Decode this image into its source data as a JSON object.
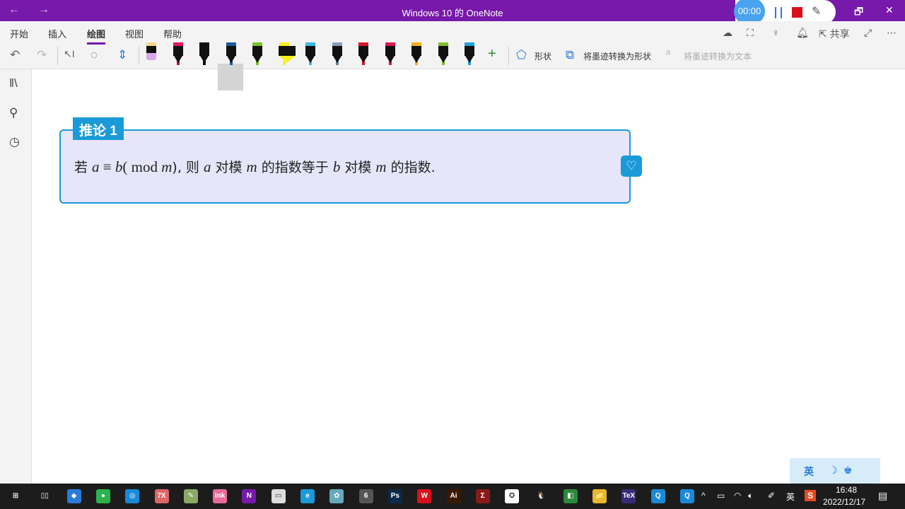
{
  "titlebar": {
    "title": "Windows 10 的 OneNote",
    "back": "←",
    "forward": "→",
    "restore": "🗗",
    "close": "✕"
  },
  "recorder": {
    "timer": "00:00"
  },
  "ribbon": {
    "tabs": [
      {
        "label": "开始"
      },
      {
        "label": "插入"
      },
      {
        "label": "绘图"
      },
      {
        "label": "视图"
      },
      {
        "label": "帮助"
      }
    ],
    "active_tab": "绘图",
    "share_label": "共享",
    "shapes_label": "形状",
    "ink_to_shape_label": "将墨迹转换为形状",
    "ink_to_text_label": "将墨迹转换为文本",
    "add_pen": "+",
    "pens": [
      {
        "cap": "#f5d890",
        "tip": "#d8a8e8",
        "type": "eraser"
      },
      {
        "cap": "#e8195a",
        "tip": "#c0103a"
      },
      {
        "cap": "#111111",
        "tip": "#111111"
      },
      {
        "cap": "#1f5a9a",
        "tip": "#1f5a9a"
      },
      {
        "cap": "#7ac12a",
        "tip": "#7ac12a"
      },
      {
        "cap": "#f5f020",
        "tip": "#f5f020"
      },
      {
        "cap": "#3cb8e8",
        "tip": "#3cb8e8"
      },
      {
        "cap": "#8aa0b8",
        "tip": "#6a8098"
      },
      {
        "cap": "#d8182a",
        "tip": "#d8182a"
      },
      {
        "cap": "#e0184a",
        "tip": "#e0184a"
      },
      {
        "cap": "#f5b020",
        "tip": "#f5b020"
      },
      {
        "cap": "#80c030",
        "tip": "#80c030"
      },
      {
        "cap": "#20a0d8",
        "tip": "#20a0d8"
      }
    ]
  },
  "note": {
    "tag": "推论 1",
    "t1": "若 ",
    "a": "a",
    "eq": " ≡ ",
    "b": "b",
    "paren": "(  ",
    "mod": "mod ",
    "m": "m",
    "t2": "), 则 ",
    "t3": " 对模 ",
    "t4": " 的指数等于 ",
    "t5": " 的指数."
  },
  "ime": {
    "lang": "英"
  },
  "taskbar": {
    "apps": [
      {
        "name": "start",
        "label": "⊞",
        "color": "transparent"
      },
      {
        "name": "task-view",
        "label": "▯▯",
        "color": "transparent"
      },
      {
        "name": "feishu",
        "label": "◆",
        "color": "#2a7ad8"
      },
      {
        "name": "wechat",
        "label": "●",
        "color": "#2bb24c"
      },
      {
        "name": "browser",
        "label": "◎",
        "color": "#1a8ad8"
      },
      {
        "name": "7x",
        "label": "7X",
        "color": "#d66"
      },
      {
        "name": "paint",
        "label": "✎",
        "color": "#8a6"
      },
      {
        "name": "app-pink",
        "label": "ink",
        "color": "#e86a9a"
      },
      {
        "name": "onenote",
        "label": "N",
        "color": "#7719aa"
      },
      {
        "name": "monitor",
        "label": "▭",
        "color": "#ddd"
      },
      {
        "name": "edge",
        "label": "e",
        "color": "#1a9ad8"
      },
      {
        "name": "app-flower",
        "label": "✿",
        "color": "#6ab"
      },
      {
        "name": "app-6",
        "label": "6",
        "color": "#555"
      },
      {
        "name": "photoshop",
        "label": "Ps",
        "color": "#0a2a48"
      },
      {
        "name": "wps",
        "label": "W",
        "color": "#d8101c"
      },
      {
        "name": "illustrator",
        "label": "Ai",
        "color": "#3a1800"
      },
      {
        "name": "app-sigma",
        "label": "Σ",
        "color": "#8a1a1a"
      },
      {
        "name": "app-gear",
        "label": "✪",
        "color": "#fff"
      },
      {
        "name": "qq",
        "label": "🐧",
        "color": "transparent"
      },
      {
        "name": "app-mixed",
        "label": "◧",
        "color": "#2a8a3a"
      },
      {
        "name": "explorer",
        "label": "📁",
        "color": "#e8b830"
      },
      {
        "name": "tex",
        "label": "TeX",
        "color": "#3a2a7a"
      },
      {
        "name": "app-q1",
        "label": "Q",
        "color": "#1a8ad8"
      },
      {
        "name": "app-q2",
        "label": "Q",
        "color": "#1a8ad8"
      }
    ],
    "lang": "英",
    "time": "16:48",
    "date": "2022/12/17"
  }
}
